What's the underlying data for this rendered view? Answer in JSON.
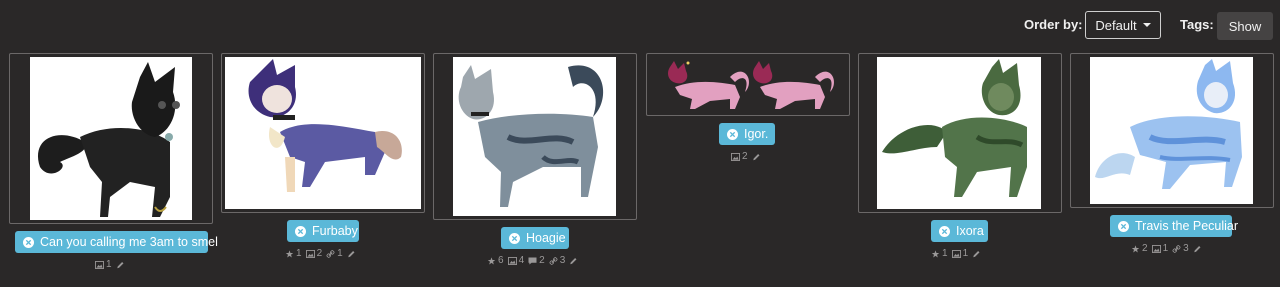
{
  "toolbar": {
    "order_label": "Order by:",
    "order_value": "Default",
    "tags_label": "Tags:",
    "show_label": "Show"
  },
  "colors": {
    "accent": "#5bb8d8",
    "background": "#2a2828"
  },
  "cards": [
    {
      "name": "Can you calling me 3am to smel",
      "images": "1"
    },
    {
      "name": "Furbaby",
      "favorites": "1",
      "images": "2",
      "links": "1"
    },
    {
      "name": "Hoagie",
      "favorites": "6",
      "images": "4",
      "comments": "2",
      "links": "3"
    },
    {
      "name": "Igor.",
      "images": "2"
    },
    {
      "name": "Ixora",
      "favorites": "1",
      "images": "1"
    },
    {
      "name": "Travis the Peculiar",
      "favorites": "2",
      "images": "1",
      "links": "3"
    }
  ]
}
